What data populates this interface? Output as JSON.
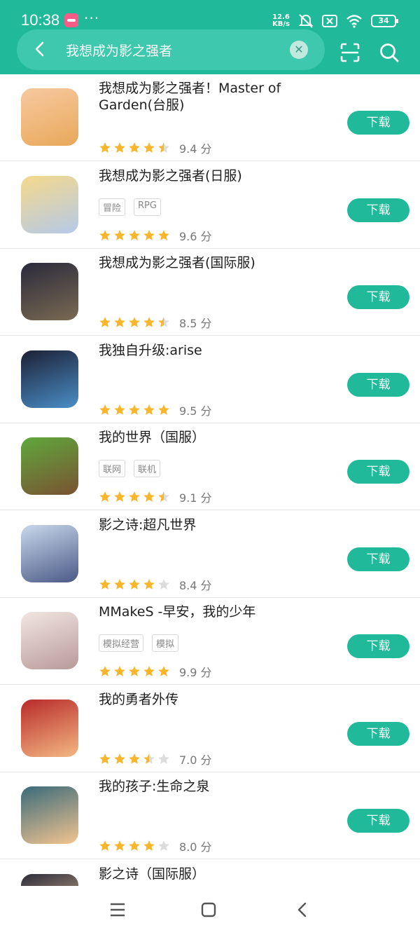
{
  "status_bar": {
    "time": "10:38",
    "dots": "···",
    "net_speed_value": "12.6",
    "net_speed_unit": "KB/s",
    "battery": "34"
  },
  "search": {
    "query": "我想成为影之强者",
    "clear_icon": "close-icon"
  },
  "apps": [
    {
      "title": "我想成为影之强者！Master of Garden(台服)",
      "tags": [],
      "rating": 4.5,
      "score": "9.4 分",
      "button": "下载",
      "icon_colors": [
        "#f7c9a0",
        "#e8a85a"
      ]
    },
    {
      "title": "我想成为影之强者(日服)",
      "tags": [
        "冒险",
        "RPG"
      ],
      "rating": 5,
      "score": "9.6 分",
      "button": "下载",
      "icon_colors": [
        "#f5d98c",
        "#b5c9e8"
      ]
    },
    {
      "title": "我想成为影之强者(国际服)",
      "tags": [],
      "rating": 4.5,
      "score": "8.5 分",
      "button": "下载",
      "icon_colors": [
        "#2a2a3c",
        "#7a6a52"
      ]
    },
    {
      "title": "我独自升级:arise",
      "tags": [],
      "rating": 5,
      "score": "9.5 分",
      "button": "下载",
      "icon_colors": [
        "#1c2035",
        "#4a8ec7"
      ]
    },
    {
      "title": "我的世界（国服）",
      "tags": [
        "联网",
        "联机"
      ],
      "rating": 4.5,
      "score": "9.1 分",
      "button": "下载",
      "icon_colors": [
        "#5fa83c",
        "#7a5232"
      ]
    },
    {
      "title": "影之诗:超凡世界",
      "tags": [],
      "rating": 4,
      "score": "8.4 分",
      "button": "下载",
      "icon_colors": [
        "#c9d8ec",
        "#4a5a86"
      ]
    },
    {
      "title": "MMakeS -早安，我的少年",
      "tags": [
        "模拟经营",
        "模拟"
      ],
      "rating": 5,
      "score": "9.9 分",
      "button": "下载",
      "icon_colors": [
        "#f2e6e0",
        "#b89a9a"
      ]
    },
    {
      "title": "我的勇者外传",
      "tags": [],
      "rating": 3.5,
      "score": "7.0 分",
      "button": "下载",
      "icon_colors": [
        "#b82a2a",
        "#f4b882"
      ]
    },
    {
      "title": "我的孩子:生命之泉",
      "tags": [],
      "rating": 4,
      "score": "8.0 分",
      "button": "下载",
      "icon_colors": [
        "#3a6a7a",
        "#f3c490"
      ]
    },
    {
      "title": "影之诗（国际服）",
      "tags": [],
      "rating": 0,
      "score": "",
      "button": "",
      "icon_colors": [
        "#2c2c3a",
        "#f3c9a0"
      ]
    }
  ],
  "colors": {
    "accent": "#20b99a",
    "star": "#f8b62c",
    "star_empty": "#dcdcdc"
  }
}
